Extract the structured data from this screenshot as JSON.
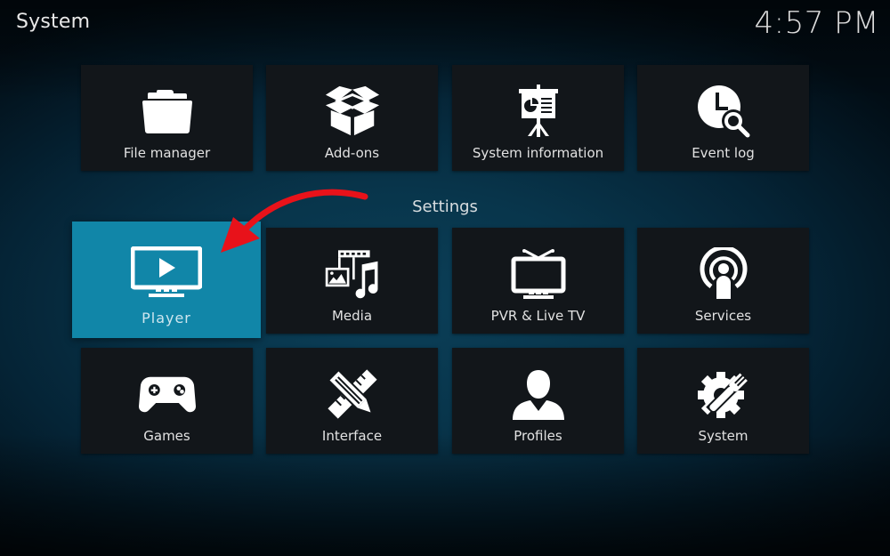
{
  "header": {
    "title": "System",
    "clock": "4:57 PM"
  },
  "section_label": "Settings",
  "tiles_top": [
    {
      "label": "File manager",
      "icon": "folder-icon"
    },
    {
      "label": "Add-ons",
      "icon": "open-box-icon"
    },
    {
      "label": "System information",
      "icon": "presentation-board-icon"
    },
    {
      "label": "Event log",
      "icon": "clock-search-icon"
    }
  ],
  "tiles_settings": [
    {
      "label": "Player",
      "icon": "monitor-play-icon",
      "focused": true
    },
    {
      "label": "Media",
      "icon": "media-icon"
    },
    {
      "label": "PVR & Live TV",
      "icon": "tv-antenna-icon"
    },
    {
      "label": "Services",
      "icon": "broadcast-person-icon"
    },
    {
      "label": "Games",
      "icon": "gamepad-icon"
    },
    {
      "label": "Interface",
      "icon": "pencil-ruler-icon"
    },
    {
      "label": "Profiles",
      "icon": "person-icon"
    },
    {
      "label": "System",
      "icon": "gear-wrench-icon"
    }
  ],
  "annotation": {
    "type": "red-arrow",
    "points_to": "Player",
    "color": "#e8121a"
  },
  "colors": {
    "focus": "#1186a8",
    "tile": "#12161a"
  }
}
